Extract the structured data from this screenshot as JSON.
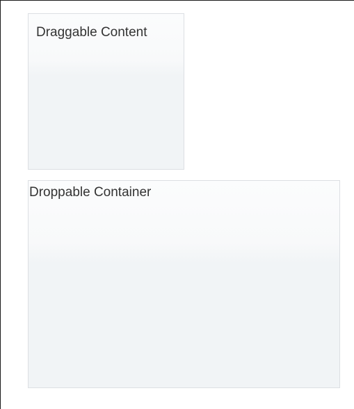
{
  "draggable": {
    "label": "Draggable Content"
  },
  "droppable": {
    "label": "Droppable Container"
  },
  "colors": {
    "box_border": "#dcdfe3",
    "box_fill": "#f1f4f6",
    "text": "#333333",
    "frame_border": "#1a1a1a"
  }
}
